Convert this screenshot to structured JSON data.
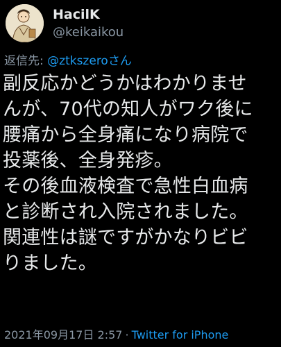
{
  "user": {
    "display_name": "HacilK",
    "handle": "@keikaikou"
  },
  "reply": {
    "prefix": "返信先: ",
    "target": "@ztkszeroさん"
  },
  "tweet": {
    "lines": [
      "副反応かどうかはわかりませ",
      "んが、70代の知人がワク後に",
      "腰痛から全身痛になり病院で",
      "投薬後、全身発疹。",
      "その後血液検査で急性白血病",
      "と診断され入院されました。",
      "関連性は謎ですがかなりビビ",
      "りました。"
    ]
  },
  "meta": {
    "timestamp": "2021年09月17日 2:57",
    "separator": "·",
    "source": "Twitter for iPhone"
  },
  "colors": {
    "background": "#000000",
    "text": "#e7e9ea",
    "muted": "#8b98a5",
    "link": "#1d9bf0"
  },
  "icons": {
    "avatar": "user-avatar-illustration"
  }
}
